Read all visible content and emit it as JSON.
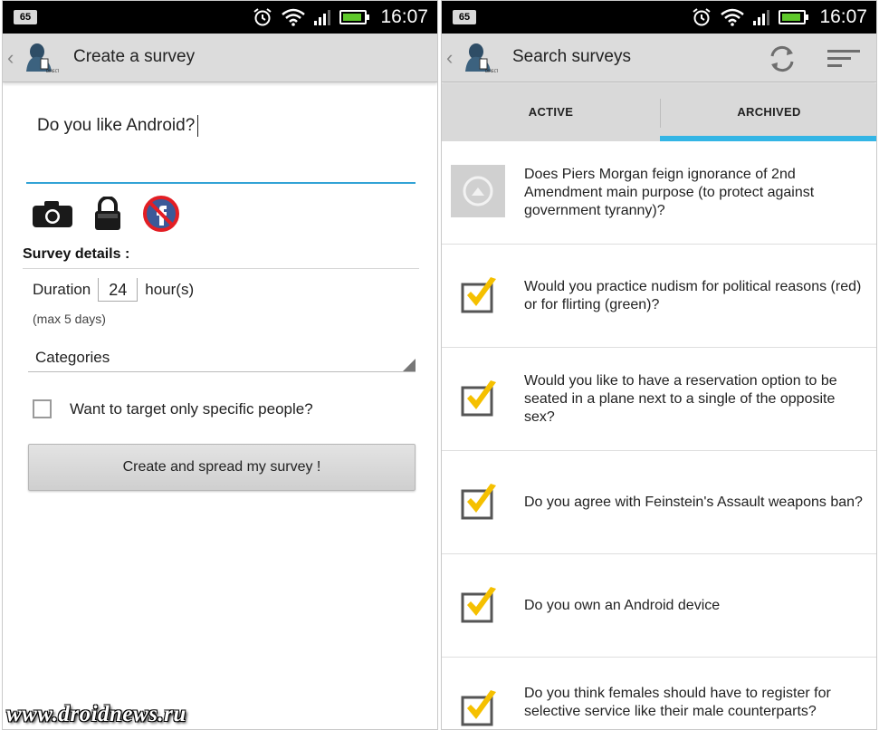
{
  "status_bar": {
    "notification_badge": "65",
    "time": "16:07"
  },
  "left": {
    "title": "Create a survey",
    "survey_question": "Do you like Android?",
    "section_title": "Survey details :",
    "duration_label": "Duration",
    "duration_value": "24",
    "duration_unit": "hour(s)",
    "max_note": "(max 5 days)",
    "categories_label": "Categories",
    "target_label": "Want to target only specific people?",
    "target_checked": false,
    "create_button": "Create and spread my survey !",
    "icons": [
      "camera-icon",
      "lock-icon",
      "facebook-disabled-icon"
    ]
  },
  "right": {
    "title": "Search surveys",
    "tabs": [
      {
        "label": "ACTIVE",
        "selected": false
      },
      {
        "label": "ARCHIVED",
        "selected": true
      }
    ],
    "items": [
      {
        "question": "Does Piers Morgan feign ignorance of 2nd Amendment main purpose (to protect against government tyranny)?",
        "icon": "image-placeholder-icon"
      },
      {
        "question": "Would you practice nudism for political reasons (red) or for flirting (green)?",
        "icon": "checkmark-icon"
      },
      {
        "question": "Would you like to have a reservation option to be seated in a plane next to a single of the opposite sex?",
        "icon": "checkmark-icon"
      },
      {
        "question": "Do you agree with Feinstein's Assault weapons ban?",
        "icon": "checkmark-icon"
      },
      {
        "question": "Do you own an Android device",
        "icon": "checkmark-icon"
      },
      {
        "question": "Do you think females should have to register for selective service like their male counterparts?",
        "icon": "checkmark-icon"
      }
    ]
  },
  "watermark": "www.droidnews.ru",
  "colors": {
    "accent": "#33b5e5",
    "checkmark": "#f5c000",
    "battery": "#5fc92b"
  }
}
